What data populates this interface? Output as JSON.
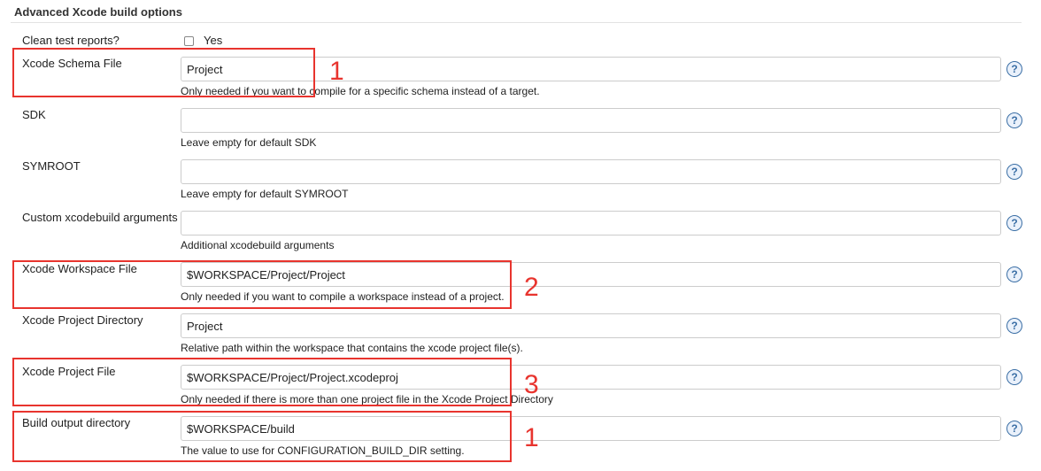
{
  "section": {
    "title": "Advanced Xcode build options"
  },
  "clean_test": {
    "label": "Clean test reports?",
    "checkbox_label": "Yes",
    "checked": false
  },
  "fields": [
    {
      "label": "Xcode Schema File",
      "value": "Project",
      "description": "Only needed if you want to compile for a specific schema instead of a target."
    },
    {
      "label": "SDK",
      "value": "",
      "description": "Leave empty for default SDK"
    },
    {
      "label": "SYMROOT",
      "value": "",
      "description": "Leave empty for default SYMROOT"
    },
    {
      "label": "Custom xcodebuild arguments",
      "value": "",
      "description": "Additional xcodebuild arguments"
    },
    {
      "label": "Xcode Workspace File",
      "value": "$WORKSPACE/Project/Project",
      "description": "Only needed if you want to compile a workspace instead of a project."
    },
    {
      "label": "Xcode Project Directory",
      "value": "Project",
      "description": "Relative path within the workspace that contains the xcode project file(s)."
    },
    {
      "label": "Xcode Project File",
      "value": "$WORKSPACE/Project/Project.xcodeproj",
      "description": "Only needed if there is more than one project file in the Xcode Project Directory"
    },
    {
      "label": "Build output directory",
      "value": "$WORKSPACE/build",
      "description": "The value to use for CONFIGURATION_BUILD_DIR setting."
    }
  ],
  "annotations": [
    {
      "number": "1",
      "color": "#e8342e"
    },
    {
      "number": "2",
      "color": "#e8342e"
    },
    {
      "number": "3",
      "color": "#e8342e"
    },
    {
      "number": "1",
      "color": "#e8342e"
    }
  ],
  "icons": {
    "help": "help-question-icon"
  },
  "colors": {
    "annotation": "#e8342e",
    "help_icon": "#3a6ea5"
  }
}
